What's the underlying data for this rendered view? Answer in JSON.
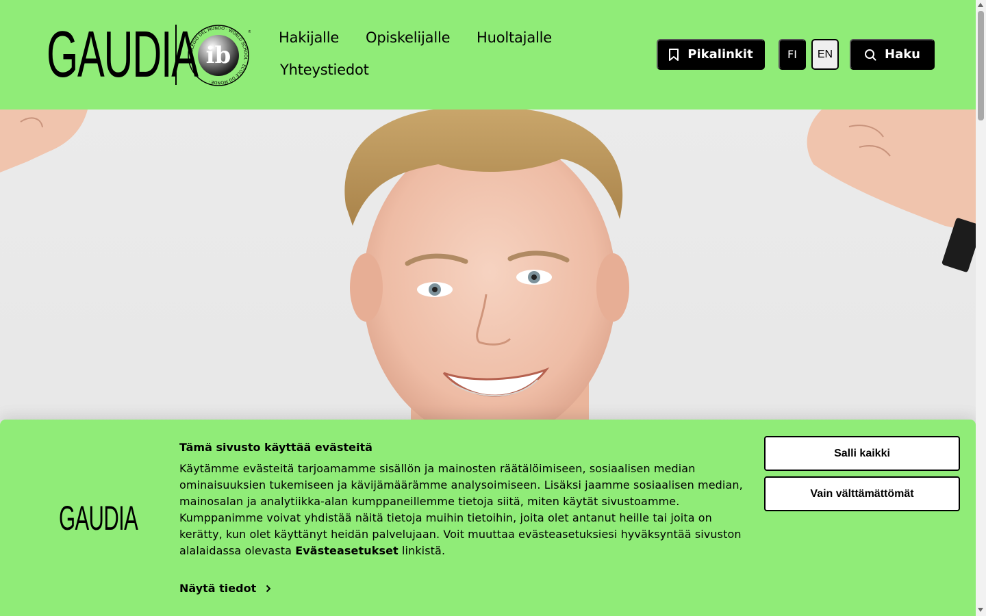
{
  "brand": {
    "wordmark": "GAUDIA",
    "ib_ring_text": "COLEGIO DEL MUNDO · WORLD SCHOOL · ÉCOLE DU MONDE ·",
    "ib_mark": "ib"
  },
  "nav": {
    "items": [
      {
        "label": "Hakijalle"
      },
      {
        "label": "Opiskelijalle"
      },
      {
        "label": "Huoltajalle"
      },
      {
        "label": "Yhteystiedot"
      }
    ]
  },
  "header_actions": {
    "quicklinks_label": "Pikalinkit",
    "lang_fi": "FI",
    "lang_en": "EN",
    "search_label": "Haku"
  },
  "cookie_banner": {
    "logo": "GAUDIA",
    "title": "Tämä sivusto käyttää evästeitä",
    "body_pre": "Käytämme evästeitä tarjoamamme sisällön ja mainosten räätälöimiseen, sosiaalisen median ominaisuuksien tukemiseen ja kävijämäärämme analysoimiseen. Lisäksi jaamme sosiaalisen median, mainosalan ja analytiikka-alan kumppaneillemme tietoja siitä, miten käytät sivustoamme. Kumppanimme voivat yhdistää näitä tietoja muihin tietoihin, joita olet antanut heille tai joita on kerätty, kun olet käyttänyt heidän palvelujaan. Voit muuttaa evästeasetuksiesi hyväksyntää sivuston alalaidassa olevasta ",
    "body_link": "Evästeasetukset",
    "body_post": " linkistä.",
    "details_label": "Näytä tiedot",
    "allow_all_label": "Salli kaikki",
    "necessary_only_label": "Vain välttämättömät"
  },
  "colors": {
    "accent_green": "#90ec78",
    "dark": "#000000"
  }
}
